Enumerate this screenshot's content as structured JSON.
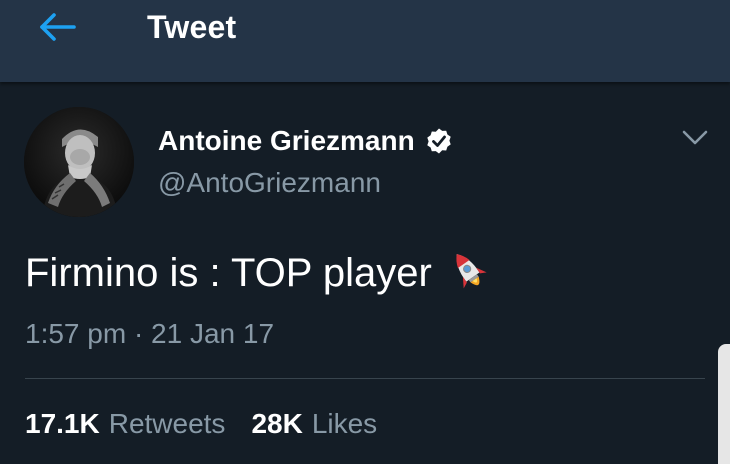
{
  "header": {
    "title": "Tweet",
    "back_icon": "arrow-left-icon",
    "accent_color": "#1da1f2",
    "background": "#243447"
  },
  "tweet": {
    "author": {
      "display_name": "Antoine Griezmann",
      "handle": "@AntoGriezmann",
      "verified": true,
      "verified_icon": "verified-badge-icon"
    },
    "text": "Firmino is : TOP player",
    "emoji": "rocket-icon",
    "timestamp": "1:57 pm · 21 Jan 17",
    "menu_icon": "chevron-down-icon"
  },
  "stats": {
    "retweets_count": "17.1K",
    "retweets_label": "Retweets",
    "likes_count": "28K",
    "likes_label": "Likes"
  },
  "colors": {
    "page_background": "#141d26",
    "secondary_text": "#8899a6",
    "divider": "#38444d"
  }
}
